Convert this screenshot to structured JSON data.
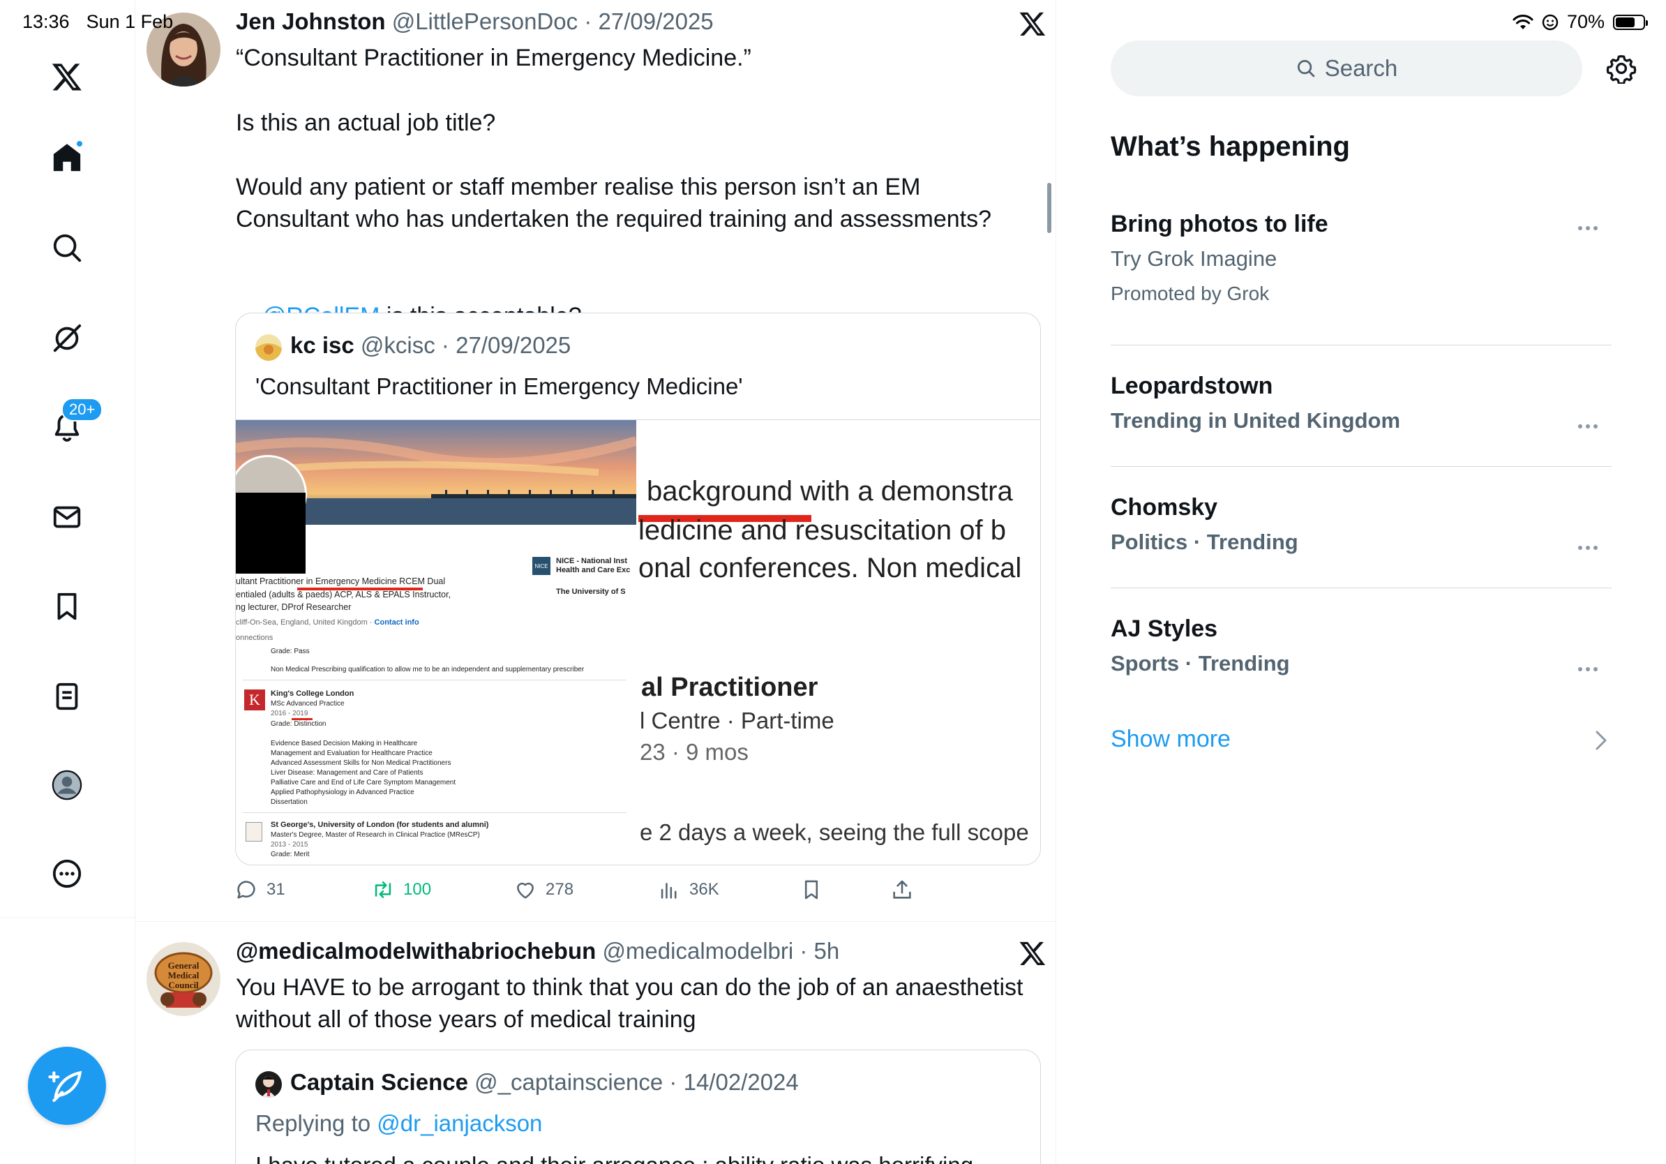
{
  "status": {
    "time": "13:36",
    "date": "Sun 1 Feb",
    "battery": "70%",
    "battery_level": 0.7
  },
  "nav": {
    "notifications_badge": "20+"
  },
  "tweets": [
    {
      "name": "Jen Johnston",
      "handle": "@LittlePersonDoc",
      "date": "27/09/2025",
      "line1": "“Consultant Practitioner in Emergency Medicine.”",
      "line2": "Is this an actual job title?",
      "line3": "Would any patient or staff member realise this person isn’t an EM",
      "line4": "Consultant who has undertaken the required training and assessments?",
      "mention": "@RCollEM",
      "line5_rest": " is this acceptable?",
      "quote": {
        "name": "kc isc",
        "handle": "@kcisc",
        "date": "27/09/2025",
        "text": "'Consultant Practitioner in Emergency Medicine'",
        "media_left": {
          "headline": "ultant Practitioner in Emergency Medicine RCEM Dual",
          "headline2": "entialed (adults & paeds) ACP, ALS & EPALS Instructor,",
          "headline3": "ng lecturer, DProf Researcher",
          "location": "cliff-On-Sea, England, United Kingdom ·",
          "contact": "Contact info",
          "connections": "onnections",
          "grade_pass": "Grade: Pass",
          "prescribing": "Non Medical Prescribing qualification to allow me to be an independent and supplementary prescriber",
          "nice1": "NICE - National Inst",
          "nice2": "Health and Care Exc",
          "uni": "The University of S",
          "kcl_name": "King's College London",
          "kcl_degree": "MSc Advanced Practice",
          "kcl_years": "2016 - 2019",
          "kcl_grade": "Grade: Distinction",
          "modules": [
            "Evidence Based Decision Making in Healthcare",
            "Management and Evaluation for Healthcare Practice",
            "Advanced Assessment Skills for Non Medical Practitioners",
            "Liver Disease: Management and Care of Patients",
            "Palliative Care and End of Life Care Symptom Management",
            "Applied Pathophysiology in Advanced Practice",
            "Dissertation"
          ],
          "sg_name": "St George's, University of London (for students and alumni)",
          "sg_degree": "Master's Degree, Master of Research in Clinical Practice (MResCP)",
          "sg_years": "2013 - 2015",
          "sg_grade": "Grade: Merit"
        },
        "media_right": {
          "l1": "background with a demonstra",
          "l2": "ledicine and resuscitation of b",
          "l3": "onal conferences. Non medical",
          "role": "al Practitioner",
          "org": "l Centre · Part-time",
          "dur": "23 · 9 mos",
          "desc": "e 2 days a week, seeing the full scope"
        }
      },
      "actions": {
        "replies": "31",
        "reposts": "100",
        "likes": "278",
        "views": "36K"
      }
    },
    {
      "name": "@medicalmodelwithabriochebun",
      "handle": "@medicalmodelbri",
      "date": "5h",
      "line1": "You HAVE to be arrogant to think that you can do the job of an anaesthetist",
      "line2": "without all of those years of medical training",
      "avatar_text": "General Medical Council",
      "quote": {
        "name": "Captain Science",
        "handle": "@_captainscience",
        "date": "14/02/2024",
        "replying": "Replying to",
        "replying_to": "@dr_ianjackson",
        "text_partial": "I have tutored a couple and their arrogance : ability ratio was horrifying"
      }
    }
  ],
  "sidebar": {
    "search_placeholder": "Search",
    "section_title": "What’s happening",
    "trends": [
      {
        "title": "Bring photos to life",
        "sub": "Try Grok Imagine",
        "promo": "Promoted by Grok"
      },
      {
        "title": "Leopardstown",
        "sub": "Trending in United Kingdom"
      },
      {
        "title": "Chomsky",
        "sub": "Politics · Trending"
      },
      {
        "title": "AJ Styles",
        "sub": "Sports · Trending"
      }
    ],
    "show_more": "Show more"
  },
  "colors": {
    "accent": "#1d9bf0",
    "repost_green": "#00ba7c",
    "secondary_text": "#536471",
    "linkedin_red_underline": "#e0261b"
  }
}
